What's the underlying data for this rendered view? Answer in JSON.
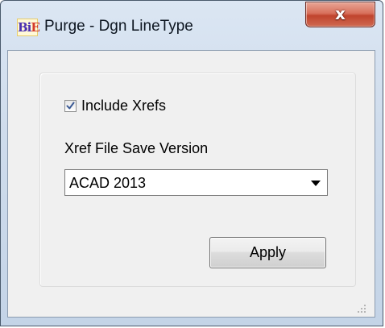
{
  "window": {
    "title": "Purge - Dgn LineType",
    "app_icon": {
      "part1": "Bi",
      "part2": "E",
      "icon": "app-logo-icon"
    },
    "close_icon": "close-icon",
    "close_glyph": "x"
  },
  "form": {
    "include_xrefs": {
      "label": "Include Xrefs",
      "checked": true
    },
    "save_version_label": "Xref File Save Version",
    "save_version": {
      "selected": "ACAD 2013",
      "icon": "chevron-down-icon"
    },
    "apply_label": "Apply"
  },
  "colors": {
    "title_bar": "#cfdcec",
    "close_button": "#c0442d",
    "client_bg": "#f0f0f0",
    "check_mark": "#3b5a94"
  }
}
